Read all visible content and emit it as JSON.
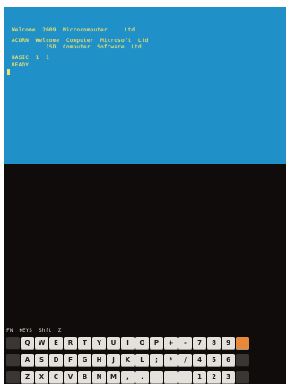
{
  "terminal": {
    "lines": [
      "Welcome  2009  Microcomputer     Ltd",
      "ACORN  Welcome  Computer  Microsoft  Ltd",
      "          1SD  Computer  Software  Ltd",
      "BASIC  1  1",
      "READY"
    ],
    "background_color": "#1f90c8",
    "text_color": "#f3e06a"
  },
  "status": {
    "text": "FN  KEYS  Shft  Z"
  },
  "keyboard": {
    "rows": [
      [
        "",
        "Q",
        "W",
        "E",
        "R",
        "T",
        "Y",
        "U",
        "I",
        "O",
        "P",
        "+",
        "-",
        "7",
        "8",
        "9",
        ""
      ],
      [
        "",
        "A",
        "S",
        "D",
        "F",
        "G",
        "H",
        "J",
        "K",
        "L",
        ";",
        "*",
        "/",
        "4",
        "5",
        "6",
        ""
      ],
      [
        "",
        "Z",
        "X",
        "C",
        "V",
        "B",
        "N",
        "M",
        ",",
        ".",
        "",
        "",
        "",
        "1",
        "2",
        "3",
        ""
      ]
    ],
    "accent_color": "#e8893a"
  }
}
